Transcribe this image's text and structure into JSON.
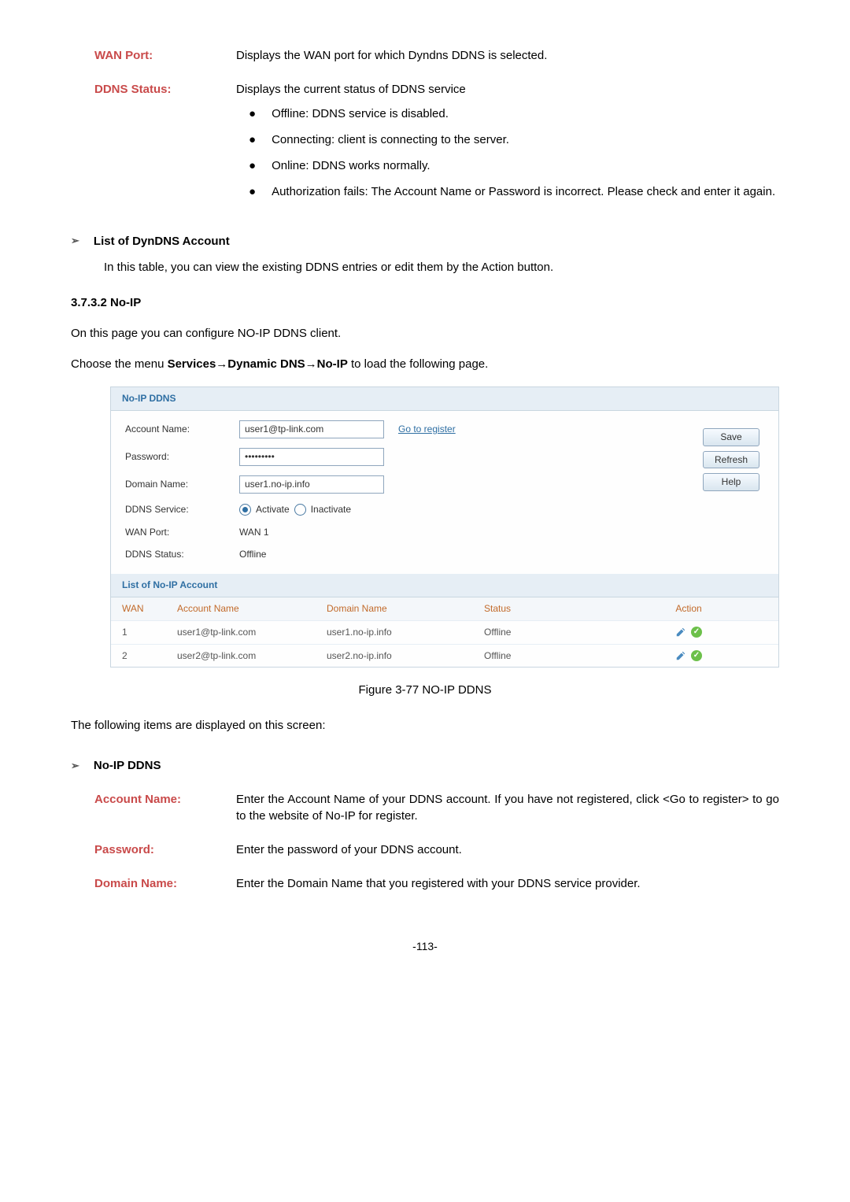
{
  "fields_top": {
    "wan_port": {
      "label": "WAN Port:",
      "desc": "Displays the WAN port for which Dyndns DDNS is selected."
    },
    "ddns_status": {
      "label": "DDNS Status:",
      "desc": "Displays the current status of DDNS service"
    },
    "status_bullets": [
      "Offline: DDNS service is disabled.",
      "Connecting: client is connecting to the server.",
      "Online: DDNS works normally.",
      "Authorization fails: The Account Name or Password is incorrect. Please check and enter it again."
    ]
  },
  "list_dyndns": {
    "heading": "List of DynDNS Account",
    "desc": "In this table, you can view the existing DDNS entries or edit them by the Action button."
  },
  "section_number": "3.7.3.2     No-IP",
  "intro1": "On this page you can configure NO-IP DDNS client.",
  "intro2_pre": "Choose the menu ",
  "intro2_bold": "Services→Dynamic DNS→No-IP",
  "intro2_post": " to load the following page.",
  "ui": {
    "section_header": "No-IP DDNS",
    "account_name_label": "Account Name:",
    "account_name_value": "user1@tp-link.com",
    "go_register": "Go to register",
    "password_label": "Password:",
    "password_value": "•••••••••",
    "domain_name_label": "Domain Name:",
    "domain_name_value": "user1.no-ip.info",
    "ddns_service_label": "DDNS Service:",
    "ddns_activate": "Activate",
    "ddns_inactivate": "Inactivate",
    "wan_port_label": "WAN Port:",
    "wan_port_value": "WAN 1",
    "ddns_status_label": "DDNS Status:",
    "ddns_status_value": "Offline",
    "btn_save": "Save",
    "btn_refresh": "Refresh",
    "btn_help": "Help",
    "list_header": "List of No-IP Account",
    "table_headers": {
      "wan": "WAN",
      "account": "Account Name",
      "domain": "Domain Name",
      "status": "Status",
      "action": "Action"
    },
    "rows": [
      {
        "wan": "1",
        "account": "user1@tp-link.com",
        "domain": "user1.no-ip.info",
        "status": "Offline"
      },
      {
        "wan": "2",
        "account": "user2@tp-link.com",
        "domain": "user2.no-ip.info",
        "status": "Offline"
      }
    ]
  },
  "figure_caption": "Figure 3-77 NO-IP DDNS",
  "displayed_intro": "The following items are displayed on this screen:",
  "noip_ddns_heading": "No-IP DDNS",
  "fields_bottom": {
    "account_name": {
      "label": "Account Name:",
      "desc": "Enter the Account Name of your DDNS account. If you have not registered, click <Go to register> to go to the website of No-IP for register."
    },
    "password": {
      "label": "Password:",
      "desc": "Enter the password of your DDNS account."
    },
    "domain_name": {
      "label": "Domain Name:",
      "desc": "Enter the Domain Name that you registered with your DDNS service provider."
    }
  },
  "page_number": "-113-"
}
